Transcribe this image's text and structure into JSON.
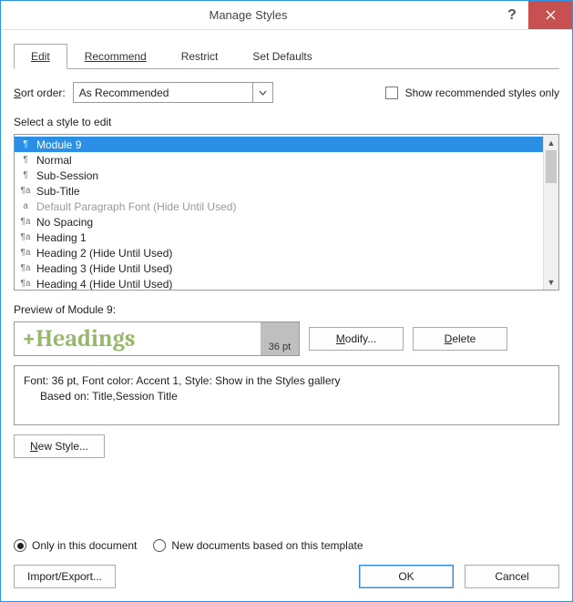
{
  "window": {
    "title": "Manage Styles"
  },
  "tabs": {
    "edit": "Edit",
    "recommend": "Recommend",
    "restrict": "Restrict",
    "set_defaults": "Set Defaults"
  },
  "sort": {
    "label_prefix": "S",
    "label_rest": "ort order:",
    "value": "As Recommended"
  },
  "show_recommended": "Show recommended styles only",
  "select_label": "Select a style to edit",
  "styles": [
    {
      "icon": "¶",
      "name": "Module 9",
      "selected": true
    },
    {
      "icon": "¶",
      "name": "Normal"
    },
    {
      "icon": "¶",
      "name": "Sub-Session"
    },
    {
      "icon": "¶a",
      "name": "Sub-Title"
    },
    {
      "icon": "a",
      "name": "Default Paragraph Font  (Hide Until Used)",
      "disabled": true
    },
    {
      "icon": "¶a",
      "name": "No Spacing"
    },
    {
      "icon": "¶a",
      "name": "Heading 1"
    },
    {
      "icon": "¶a",
      "name": "Heading 2  (Hide Until Used)"
    },
    {
      "icon": "¶a",
      "name": "Heading 3  (Hide Until Used)"
    },
    {
      "icon": "¶a",
      "name": "Heading 4  (Hide Until Used)"
    }
  ],
  "preview": {
    "label": "Preview of Module 9:",
    "text": "+Headings",
    "size": "36 pt"
  },
  "buttons": {
    "modify_u": "M",
    "modify_rest": "odify...",
    "delete_u": "D",
    "delete_rest": "elete",
    "newstyle_u": "N",
    "newstyle_rest": "ew Style...",
    "import_export": "Import/Export...",
    "ok": "OK",
    "cancel": "Cancel"
  },
  "description": {
    "line1": "Font: 36 pt, Font color: Accent 1, Style: Show in the Styles gallery",
    "line2": "Based on: Title,Session Title"
  },
  "radios": {
    "this_doc": "Only in this document",
    "template": "New documents based on this template"
  }
}
